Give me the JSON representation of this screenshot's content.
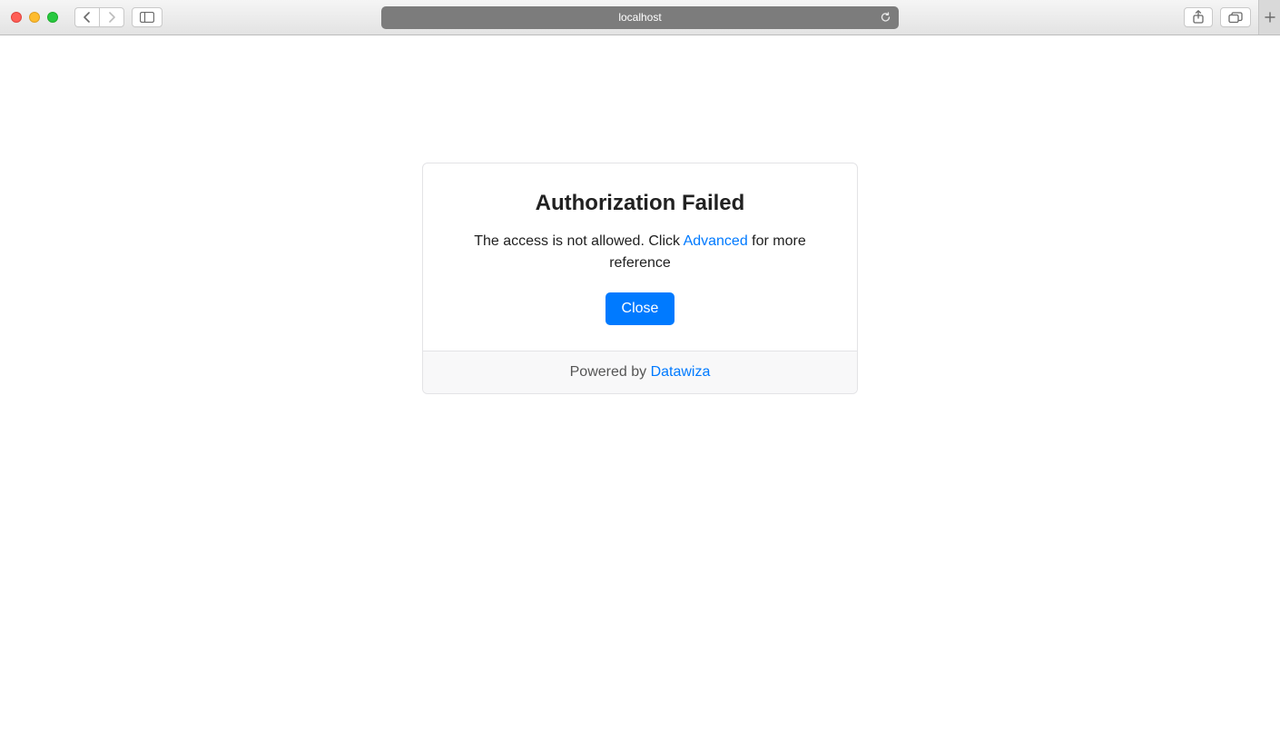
{
  "browser": {
    "url": "localhost"
  },
  "dialog": {
    "title": "Authorization Failed",
    "message_prefix": "The access is not allowed. Click ",
    "advanced_link": "Advanced",
    "message_suffix": " for more reference",
    "close_button": "Close"
  },
  "footer": {
    "powered_by": "Powered by ",
    "brand": "Datawiza"
  }
}
